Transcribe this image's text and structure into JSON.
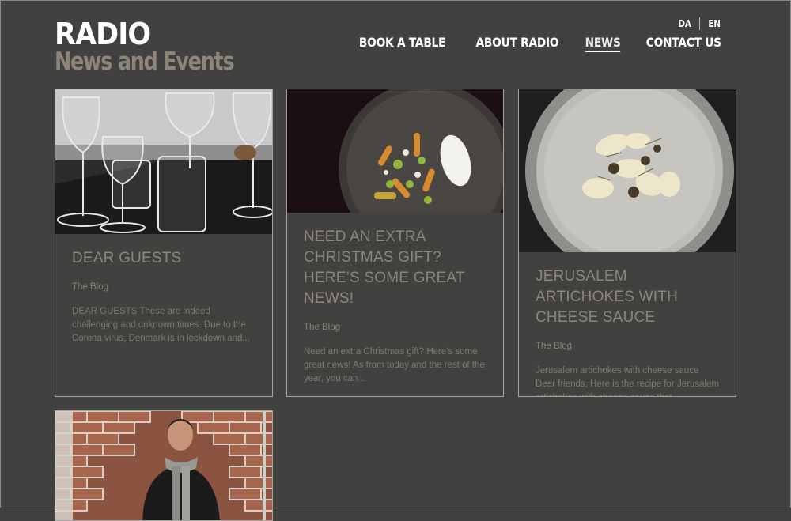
{
  "site": {
    "logo": "RADIO",
    "page_title": "News and Events"
  },
  "languages": [
    "DA",
    "EN"
  ],
  "nav": {
    "items": [
      "BOOK A TABLE",
      "ABOUT RADIO",
      "NEWS",
      "CONTACT US"
    ],
    "active": "NEWS"
  },
  "posts": [
    {
      "title": "DEAR GUESTS",
      "category": "The Blog",
      "excerpt": "DEAR GUESTS   These are indeed challenging and unknown times. Due to the Corona virus, Denmark is in lockdown and...",
      "image": "wine-glasses-photo"
    },
    {
      "title": "NEED AN EXTRA CHRISTMAS GIFT? HERE’S SOME GREAT NEWS!",
      "category": "The Blog",
      "excerpt": "Need an extra Christmas gift? Here’s some great news! As from today and the rest of the year, you can...",
      "image": "carrot-dish-photo"
    },
    {
      "title": "JERUSALEM ARTICHOKES WITH CHEESE SAUCE",
      "category": "The Blog",
      "excerpt": "Jerusalem artichokes with cheese sauce   Dear friends, Here is the recipe for Jerusalem artichokes with cheese sauce that...",
      "image": "artichoke-dish-photo"
    },
    {
      "title": "",
      "category": "",
      "excerpt": "",
      "image": "chef-portrait-photo"
    }
  ],
  "colors": {
    "background": "#414140",
    "card_border": "#a3a3a0",
    "accent_text": "#8d857a",
    "nav_text": "#ffffff"
  }
}
